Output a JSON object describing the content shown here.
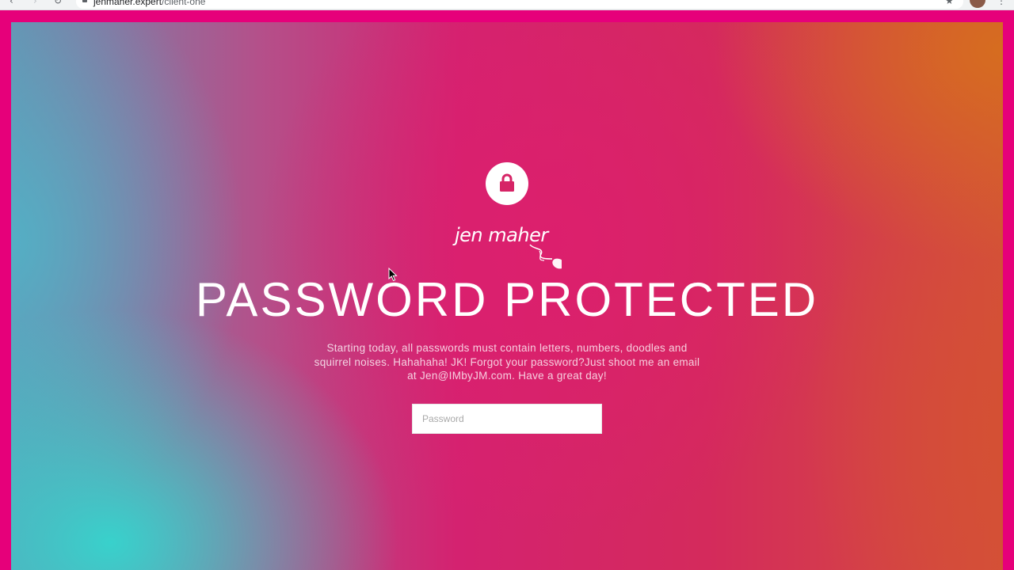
{
  "browser": {
    "url_host": "jenmaher.expert",
    "url_path": "/client-one"
  },
  "logo": {
    "text": "jen maher"
  },
  "page": {
    "title": "PASSWORD PROTECTED",
    "message": "Starting today, all passwords must contain letters, numbers, doodles and squirrel noises. Hahahaha!  JK!  Forgot your password?Just shoot me an email at Jen@IMbyJM.com. Have a great day!",
    "password_placeholder": "Password",
    "password_value": ""
  },
  "icons": {
    "lock": "lock-icon",
    "mouse": "computer-mouse-icon",
    "cursor": "mouse-pointer-icon"
  },
  "colors": {
    "frame": "#e6007a",
    "lock_fg": "#d62466",
    "text": "#ffffff"
  }
}
